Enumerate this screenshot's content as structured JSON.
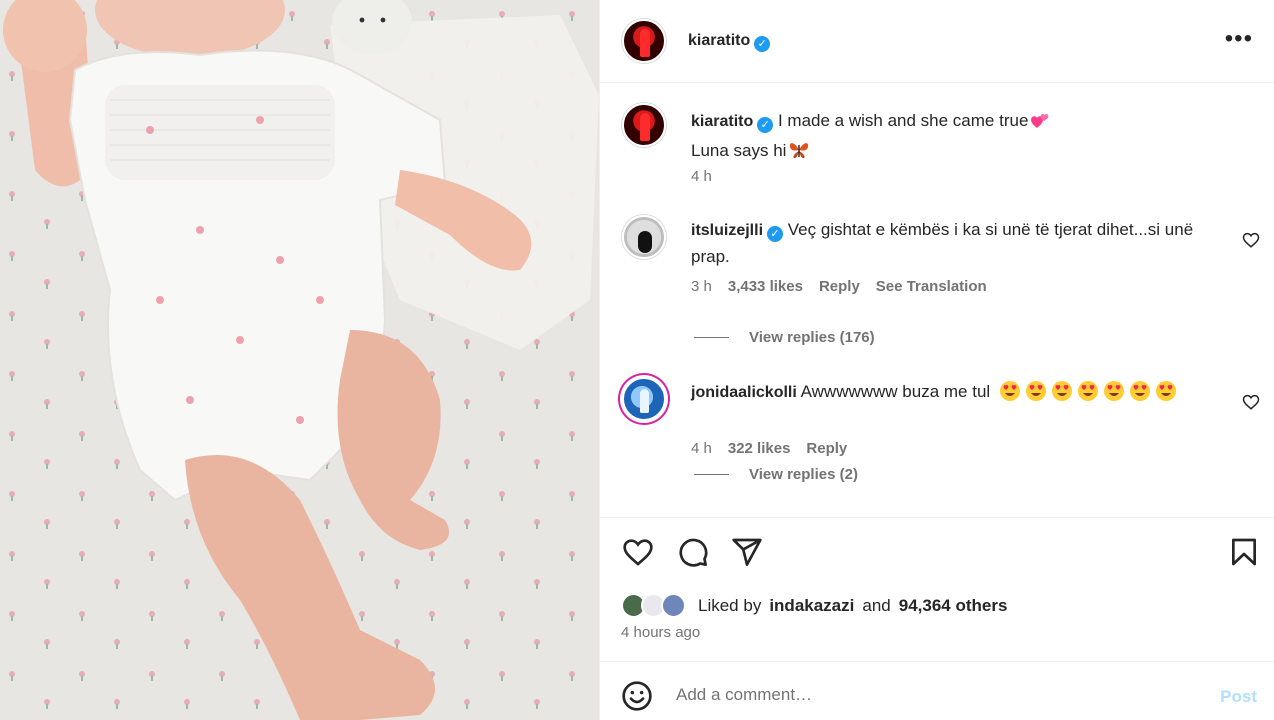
{
  "post": {
    "author": "kiaratito",
    "verified": true,
    "more_icon": "more-horizontal-icon",
    "caption_line1": "I made a wish and she came true",
    "caption_line1_emoji": "two-hearts-emoji",
    "caption_line2": "Luna says hi",
    "caption_line2_emoji": "butterfly-emoji",
    "caption_time": "4 h"
  },
  "comments": [
    {
      "username": "itsluizejlli",
      "verified": true,
      "text": "Veç gishtat e këmbës i ka si unë të tjerat dihet...si unë prap.",
      "time": "3 h",
      "likes": "3,433 likes",
      "reply": "Reply",
      "translation": "See Translation",
      "view_replies": "View replies (176)"
    },
    {
      "username": "jonidaalickolli",
      "verified": false,
      "text": "Awwwwwww buza me tul",
      "emoji_count": 7,
      "emoji": "heart-eyes-emoji",
      "time": "4 h",
      "likes": "322 likes",
      "reply": "Reply",
      "view_replies": "View replies (2)"
    }
  ],
  "actions": {
    "like_icon": "heart-icon",
    "comment_icon": "comment-icon",
    "share_icon": "share-icon",
    "save_icon": "bookmark-icon"
  },
  "likes": {
    "prefix": "Liked by",
    "user": "indakazazi",
    "joiner": "and",
    "count": "94,364 others"
  },
  "posted_ago": "4 hours ago",
  "add_comment": {
    "placeholder": "Add a comment…",
    "post_label": "Post",
    "emoji_icon": "smiley-icon"
  },
  "colors": {
    "verified": "#1d9bf0",
    "muted_text": "#737373",
    "post_button_disabled": "#b2dffc",
    "divider": "#efefef"
  }
}
